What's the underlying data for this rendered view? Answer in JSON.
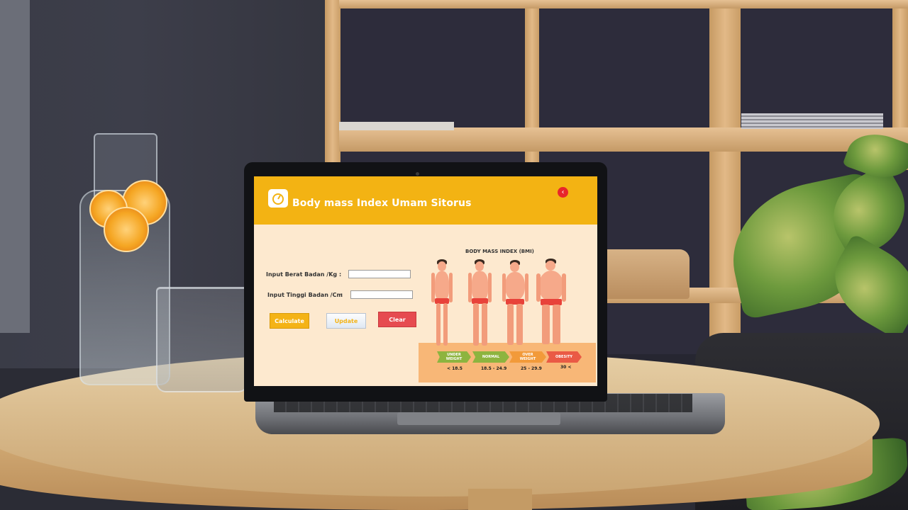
{
  "app": {
    "title": "Body mass Index Umam Sitorus",
    "icon": "scale-icon",
    "close_icon": "close-icon"
  },
  "form": {
    "weight_label": "Input Berat Badan /Kg",
    "height_label": "Input Tinggi Badan /Cm",
    "colon": ":",
    "weight_value": "",
    "height_value": ""
  },
  "buttons": {
    "calculate": "Calculate",
    "update": "Update",
    "clear": "Clear"
  },
  "bmi_chart": {
    "title": "BODY MASS INDEX (BMI)",
    "categories": [
      {
        "label_line1": "UNDER",
        "label_line2": "WEIGHT",
        "range": "< 18.5",
        "color": "#8db43f"
      },
      {
        "label_line1": "NORMAL",
        "label_line2": "",
        "range": "18.5 - 24.9",
        "color": "#8db43f"
      },
      {
        "label_line1": "OVER",
        "label_line2": "WEIGHT",
        "range": "25 - 29.9",
        "color": "#f29a3a"
      },
      {
        "label_line1": "OBESITY",
        "label_line2": "",
        "range": "30 <",
        "color": "#ea5a45"
      }
    ]
  },
  "colors": {
    "titlebar": "#f3b313",
    "background": "#fde9cf",
    "clear_button": "#e64b50"
  }
}
